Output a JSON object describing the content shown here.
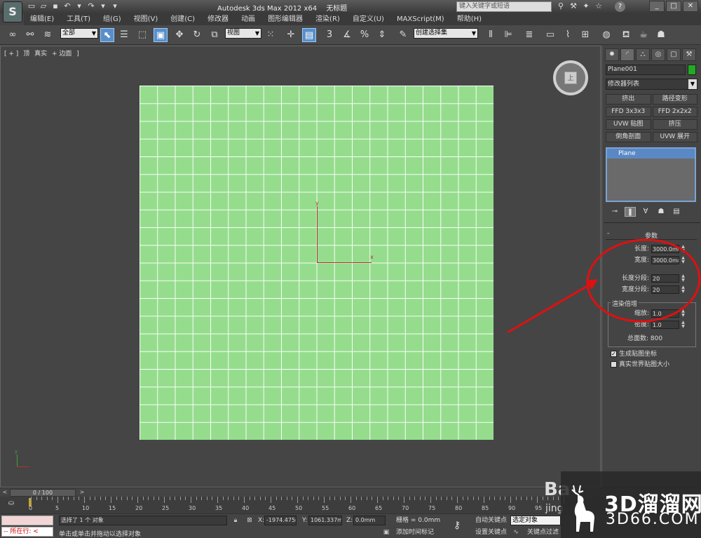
{
  "title": {
    "segments": [
      "Autodesk 3ds Max  2012 x64",
      "无标题"
    ],
    "search_placeholder": "键入关键字或短语"
  },
  "menu": [
    "编辑(E)",
    "工具(T)",
    "组(G)",
    "视图(V)",
    "创建(C)",
    "修改器",
    "动画",
    "图形编辑器",
    "渲染(R)",
    "自定义(U)",
    "MAXScript(M)",
    "帮助(H)"
  ],
  "toolbar": {
    "selection_filter": "全部",
    "reference_coord": "视图",
    "angle_snap_label": "3",
    "named_selection": "创建选择集"
  },
  "viewport": {
    "label_parts": [
      "[ + ]",
      "顶",
      "真实",
      "+ 边面",
      "]"
    ],
    "viewcube_face": "上",
    "gizmo_x": "x",
    "gizmo_y": "y",
    "mini_axis_y": "y",
    "plane_color": "#95dd8d",
    "grid_divisions": 20
  },
  "command_panel": {
    "object_name": "Plane001",
    "object_color": "#22aa22",
    "modifier_list": "修改器列表",
    "modifier_buttons": [
      "挤出",
      "路径变形",
      "FFD 3x3x3",
      "FFD 2x2x2",
      "UVW 贴图",
      "挤压",
      "倒角剖面",
      "UVW 展开"
    ],
    "stack_item": "Plane",
    "rollout_title": "参数",
    "rollout_toggle": "-",
    "params": [
      {
        "label": "长度:",
        "value": "3000.0mm"
      },
      {
        "label": "宽度:",
        "value": "3000.0mm"
      },
      {
        "label": "长度分段:",
        "value": "20"
      },
      {
        "label": "宽度分段:",
        "value": "20"
      }
    ],
    "render_group_title": "渲染倍增",
    "render_params": [
      {
        "label": "缩放:",
        "value": "1.0"
      },
      {
        "label": "密度:",
        "value": "1.0"
      }
    ],
    "total_faces": "总面数: 800",
    "checkboxes": [
      {
        "label": "生成贴图坐标",
        "checked": true
      },
      {
        "label": "真实世界贴图大小",
        "checked": false
      }
    ]
  },
  "timeline": {
    "frame_display": "0 / 100",
    "ruler_labels": [
      "0",
      "5",
      "10",
      "15",
      "20",
      "25",
      "30",
      "35",
      "40",
      "45",
      "50",
      "55",
      "60",
      "65",
      "70",
      "75",
      "80",
      "85",
      "90",
      "95"
    ]
  },
  "status": {
    "mini_listener": "-- 所在行: <",
    "selection_msg": "选择了 1 个 对象",
    "prompt_msg": "单击或单击并拖动以选择对象",
    "x_label": "X:",
    "x_value": "-1974.475n",
    "y_label": "Y:",
    "y_value": "1061.337m",
    "z_label": "Z:",
    "z_value": "0.0mm",
    "grid": "栅格 = 0.0mm",
    "add_time_tag": "添加时间标记",
    "auto_key": "自动关键点",
    "set_key": "设置关键点",
    "key_filter": "关键点过滤",
    "selected_objects": "选定对象"
  },
  "watermark": {
    "main": "3D溜溜网",
    "sub": "3D66.COM",
    "ba": "Ba",
    "jing": "jing"
  },
  "colors": {
    "annotation": "#e01010",
    "accent": "#5a8ec8"
  }
}
